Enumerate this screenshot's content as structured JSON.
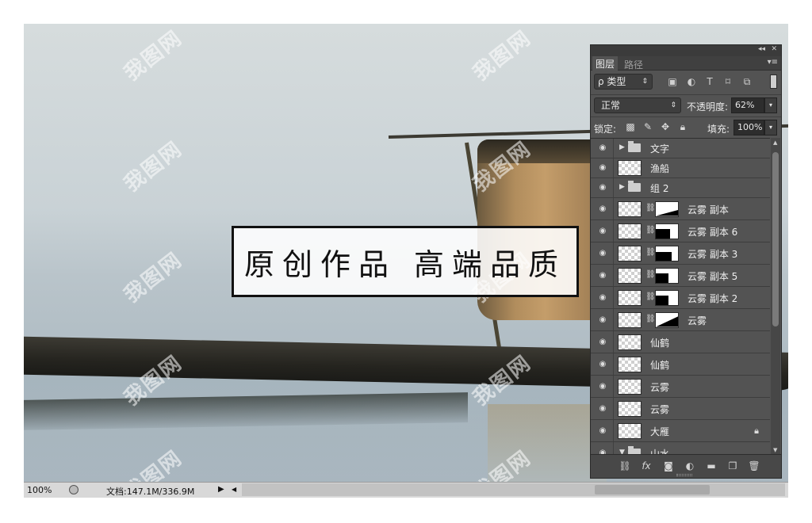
{
  "canvas": {
    "title_text": "原创作品  高端品质",
    "watermark_text": "我图网"
  },
  "status_bar": {
    "zoom": "100%",
    "doc_info": "文档:147.1M/336.9M"
  },
  "layers_panel": {
    "tabs": [
      "图层",
      "路径"
    ],
    "filter_label": "ρ 类型",
    "blend_mode": "正常",
    "opacity_label": "不透明度:",
    "opacity_value": "62%",
    "lock_label": "锁定:",
    "fill_label": "填充:",
    "fill_value": "100%",
    "layers": [
      {
        "name": "文字",
        "kind": "group",
        "expanded": false
      },
      {
        "name": "渔船",
        "kind": "pixel"
      },
      {
        "name": "组 2",
        "kind": "group",
        "expanded": false
      },
      {
        "name": "云雾 副本",
        "kind": "masked"
      },
      {
        "name": "云雾 副本 6",
        "kind": "masked"
      },
      {
        "name": "云雾 副本 3",
        "kind": "masked"
      },
      {
        "name": "云雾 副本 5",
        "kind": "masked"
      },
      {
        "name": "云雾 副本 2",
        "kind": "masked"
      },
      {
        "name": "云雾",
        "kind": "masked"
      },
      {
        "name": "仙鹤",
        "kind": "pixel"
      },
      {
        "name": "仙鹤",
        "kind": "pixel"
      },
      {
        "name": "云雾",
        "kind": "pixel"
      },
      {
        "name": "云雾",
        "kind": "pixel"
      },
      {
        "name": "大雁",
        "kind": "pixel",
        "locked": true
      },
      {
        "name": "山水",
        "kind": "group",
        "expanded": true
      }
    ],
    "bottom_icons": [
      "link-icon",
      "fx-icon",
      "mask-icon",
      "adjustment-icon",
      "folder-icon",
      "new-layer-icon",
      "trash-icon"
    ]
  }
}
